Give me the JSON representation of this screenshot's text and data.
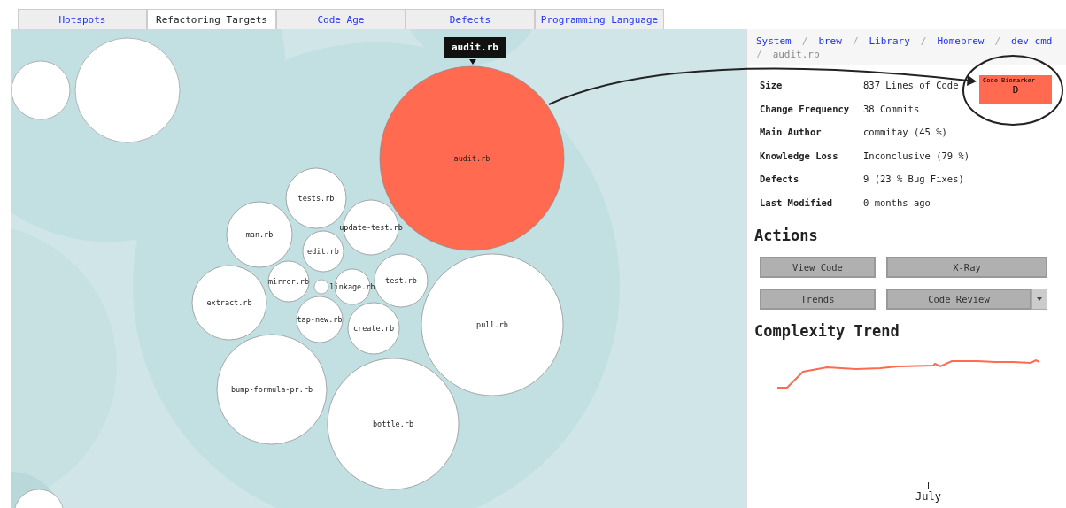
{
  "tabs": [
    {
      "label": "Hotspots",
      "selected": false
    },
    {
      "label": "Refactoring Targets",
      "selected": true
    },
    {
      "label": "Code Age",
      "selected": false
    },
    {
      "label": "Defects",
      "selected": false
    },
    {
      "label": "Programming Language",
      "selected": false
    }
  ],
  "map": {
    "tooltip": "audit.rb",
    "files": [
      {
        "label": "audit.rb",
        "selected": true
      },
      {
        "label": "pull.rb",
        "selected": false
      },
      {
        "label": "bottle.rb",
        "selected": false
      },
      {
        "label": "bump-formula-pr.rb",
        "selected": false
      },
      {
        "label": "extract.rb",
        "selected": false
      },
      {
        "label": "man.rb",
        "selected": false
      },
      {
        "label": "tests.rb",
        "selected": false
      },
      {
        "label": "update-test.rb",
        "selected": false
      },
      {
        "label": "edit.rb",
        "selected": false
      },
      {
        "label": "test.rb",
        "selected": false
      },
      {
        "label": "mirror.rb",
        "selected": false
      },
      {
        "label": "linkage.rb",
        "selected": false
      },
      {
        "label": "tap-new.rb",
        "selected": false
      },
      {
        "label": "create.rb",
        "selected": false
      }
    ]
  },
  "breadcrumb": {
    "links": [
      "System",
      "brew",
      "Library",
      "Homebrew",
      "dev-cmd"
    ],
    "separator": "/",
    "current": "audit.rb"
  },
  "biomarker": {
    "label": "Code Biomarker",
    "grade": "D",
    "color": "#ff6a50"
  },
  "details": [
    {
      "label": "Size",
      "value": "837 Lines of Code"
    },
    {
      "label": "Change Frequency",
      "value": "38 Commits"
    },
    {
      "label": "Main Author",
      "value": "commitay (45 %)"
    },
    {
      "label": "Knowledge Loss",
      "value": "Inconclusive (79 %)"
    },
    {
      "label": "Defects",
      "value": "9 (23 % Bug Fixes)"
    },
    {
      "label": "Last Modified",
      "value": "0 months ago"
    }
  ],
  "actions": {
    "title": "Actions",
    "buttons": [
      {
        "label": "View Code",
        "kind": "plain"
      },
      {
        "label": "X-Ray",
        "kind": "plain"
      },
      {
        "label": "Trends",
        "kind": "plain"
      },
      {
        "label": "Code Review",
        "kind": "split"
      }
    ]
  },
  "complexity_trend": {
    "title": "Complexity Trend",
    "axis_label": "July"
  }
}
